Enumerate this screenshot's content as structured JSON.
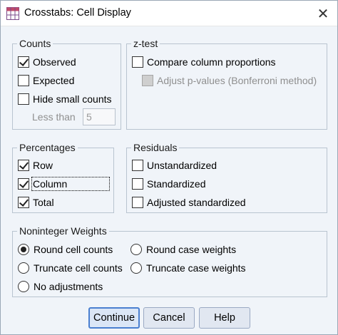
{
  "window": {
    "title": "Crosstabs: Cell Display",
    "close_glyph": "✕"
  },
  "counts": {
    "legend": "Counts",
    "observed": "Observed",
    "expected": "Expected",
    "hide_small": "Hide small counts",
    "less_than_label": "Less than",
    "less_than_value": "5"
  },
  "ztest": {
    "legend": "z-test",
    "compare": "Compare column proportions",
    "adjust": "Adjust p-values (Bonferroni method)"
  },
  "percentages": {
    "legend": "Percentages",
    "row": "Row",
    "column": "Column",
    "total": "Total"
  },
  "residuals": {
    "legend": "Residuals",
    "unstandardized": "Unstandardized",
    "standardized": "Standardized",
    "adjusted": "Adjusted standardized"
  },
  "weights": {
    "legend": "Noninteger Weights",
    "round_cell": "Round cell counts",
    "round_case": "Round case weights",
    "truncate_cell": "Truncate cell counts",
    "truncate_case": "Truncate case weights",
    "no_adjust": "No adjustments"
  },
  "buttons": {
    "continue": "Continue",
    "cancel": "Cancel",
    "help": "Help"
  },
  "colors": {
    "window_bg": "#f0f4f9",
    "default_button_border": "#4a7fd0"
  },
  "icons": {
    "app": "crosstabs-table-icon",
    "close": "close-icon"
  }
}
